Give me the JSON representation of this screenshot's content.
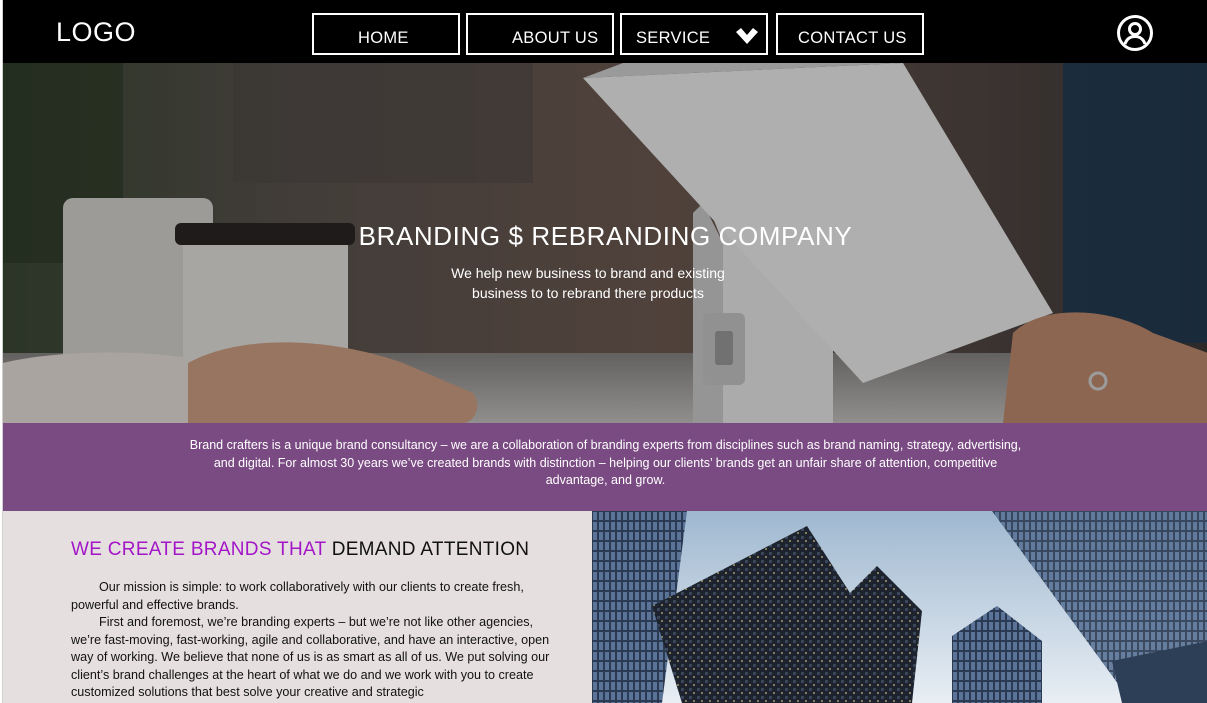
{
  "nav": {
    "logo": "LOGO",
    "items": [
      {
        "label": "HOME"
      },
      {
        "label": "ABOUT US"
      },
      {
        "label": "SERVICE"
      },
      {
        "label": "CONTACT US"
      }
    ],
    "dropdown_icon": "chevron-down-icon",
    "account_icon": "user-circle-icon"
  },
  "hero": {
    "title": "BRANDING $ REBRANDING COMPANY",
    "subtitle_line1": "We help new business to brand and existing",
    "subtitle_line2": "business to to rebrand there products"
  },
  "band": {
    "text": "Brand crafters is a unique brand consultancy – we are a collaboration of branding experts from disciplines such as brand naming, strategy, advertising, and digital. For almost 30 years we’ve created brands with distinction – helping our clients’ brands get an unfair share of attention, competitive advantage, and grow."
  },
  "about": {
    "title_accent": "WE CREATE BRANDS THAT",
    "title_dark": "DEMAND ATTENTION",
    "paragraph1": "Our mission is simple: to work collaboratively with our clients to create fresh, powerful and effective brands.",
    "paragraph2": "First and foremost, we’re branding experts – but we’re not like other agencies, we’re fast-moving, fast-working, agile and collaborative, and have an interactive, open way of working. We believe that none of us is as smart as all of us. We put solving our client’s brand challenges at the heart of what we do and we work with you to create customized solutions that best solve your creative and strategic"
  },
  "colors": {
    "nav_bg": "#000000",
    "band_bg": "#7a4a82",
    "accent": "#a316c8",
    "lower_bg": "#e6dfdf"
  }
}
